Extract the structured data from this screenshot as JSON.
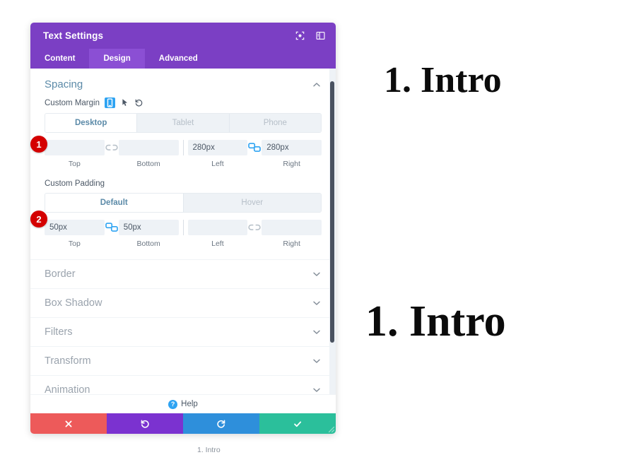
{
  "panel": {
    "title": "Text Settings",
    "titlebar_icons": [
      {
        "name": "expand-icon"
      },
      {
        "name": "layout-toggle-icon"
      }
    ],
    "tabs": [
      {
        "label": "Content",
        "active": false
      },
      {
        "label": "Design",
        "active": true
      },
      {
        "label": "Advanced",
        "active": false
      }
    ],
    "spacing": {
      "title": "Spacing",
      "custom_margin": {
        "label": "Custom Margin",
        "responsive_icon": "responsive-tablet-icon",
        "hover_icon": "cursor-pointer-icon",
        "reset_icon": "reset-undo-icon"
      },
      "devices": [
        {
          "label": "Desktop",
          "active": true
        },
        {
          "label": "Tablet",
          "active": false
        },
        {
          "label": "Phone",
          "active": false
        }
      ],
      "margin_fields": {
        "top": {
          "caption": "Top",
          "value": "",
          "placeholder": ""
        },
        "bottom": {
          "caption": "Bottom",
          "value": "",
          "placeholder": ""
        },
        "left": {
          "caption": "Left",
          "value": "280px",
          "placeholder": ""
        },
        "right": {
          "caption": "Right",
          "value": "280px",
          "placeholder": ""
        },
        "top_bottom_link": "unlinked",
        "left_right_link": "linked"
      },
      "custom_padding": {
        "label": "Custom Padding",
        "states": [
          {
            "label": "Default",
            "active": true
          },
          {
            "label": "Hover",
            "active": false
          }
        ]
      },
      "padding_fields": {
        "top": {
          "caption": "Top",
          "value": "50px",
          "placeholder": ""
        },
        "bottom": {
          "caption": "Bottom",
          "value": "50px",
          "placeholder": ""
        },
        "left": {
          "caption": "Left",
          "value": "",
          "placeholder": ""
        },
        "right": {
          "caption": "Right",
          "value": "",
          "placeholder": ""
        },
        "top_bottom_link": "linked",
        "left_right_link": "unlinked"
      }
    },
    "collapsed_sections": [
      {
        "label": "Border"
      },
      {
        "label": "Box Shadow"
      },
      {
        "label": "Filters"
      },
      {
        "label": "Transform"
      },
      {
        "label": "Animation"
      }
    ],
    "help": {
      "label": "Help",
      "icon": "question-mark-icon"
    },
    "footer_buttons": [
      {
        "name": "cancel-button",
        "icon": "close-x-icon",
        "color": "#ed5a5a"
      },
      {
        "name": "undo-button",
        "icon": "undo-arrow-icon",
        "color": "#7b32d0"
      },
      {
        "name": "redo-button",
        "icon": "redo-arrow-icon",
        "color": "#2e8fdb"
      },
      {
        "name": "save-button",
        "icon": "checkmark-icon",
        "color": "#2bbf9b"
      }
    ],
    "caption": "1. Intro"
  },
  "step_badges": [
    {
      "number": "1"
    },
    {
      "number": "2"
    }
  ],
  "page_content": {
    "heading_top": "1. Intro",
    "heading_bottom": "1. Intro"
  },
  "colors": {
    "panel_purple": "#7b3fc4",
    "tab_active_purple": "#8b4fd4",
    "accent_blue": "#2ea3f2",
    "section_teal": "#5b8aa8",
    "badge_red": "#d40000"
  }
}
